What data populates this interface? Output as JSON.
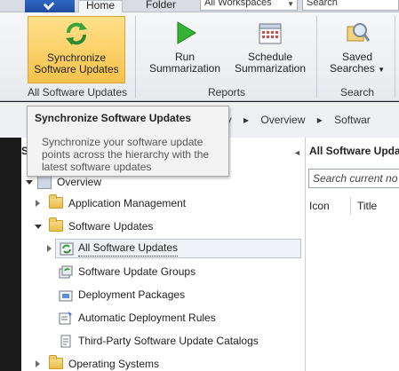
{
  "ribbon_tabs": [
    {
      "label": "Home",
      "active": true
    },
    {
      "label": "Folder",
      "active": false
    }
  ],
  "workspace_combo": {
    "value": "All Workspaces"
  },
  "search_combo": {
    "value": "Search"
  },
  "ribbon": {
    "sync_button": {
      "line1": "Synchronize",
      "line2": "Software Updates"
    },
    "run_button": {
      "line1": "Run",
      "line2": "Summarization"
    },
    "schedule_button": {
      "line1": "Schedule",
      "line2": "Summarization"
    },
    "saved_button": {
      "line1": "Saved",
      "line2": "Searches"
    },
    "groups": {
      "all_software_updates": "All Software Updates",
      "reports": "Reports",
      "search": "Search"
    }
  },
  "breadcrumb": [
    "rary",
    "Overview",
    "Softwar"
  ],
  "tooltip": {
    "title": "Synchronize Software Updates",
    "body": "Synchronize your software update points across the hierarchy with the latest software updates"
  },
  "left_pane": {
    "header_initial": "S",
    "tree": [
      {
        "label": "Overview"
      },
      {
        "label": "Application Management"
      },
      {
        "label": "Software Updates"
      },
      {
        "label": "All Software Updates"
      },
      {
        "label": "Software Update Groups"
      },
      {
        "label": "Deployment Packages"
      },
      {
        "label": "Automatic Deployment Rules"
      },
      {
        "label": "Third-Party Software Update Catalogs"
      },
      {
        "label": "Operating Systems"
      }
    ]
  },
  "right_pane": {
    "title": "All Software Upda",
    "search_placeholder": "Search current no",
    "columns": [
      "Icon",
      "Title"
    ]
  },
  "colors": {
    "selected_button": "#f7c24a",
    "app_button": "#2f66c4",
    "folder": "#e9bd4c"
  }
}
